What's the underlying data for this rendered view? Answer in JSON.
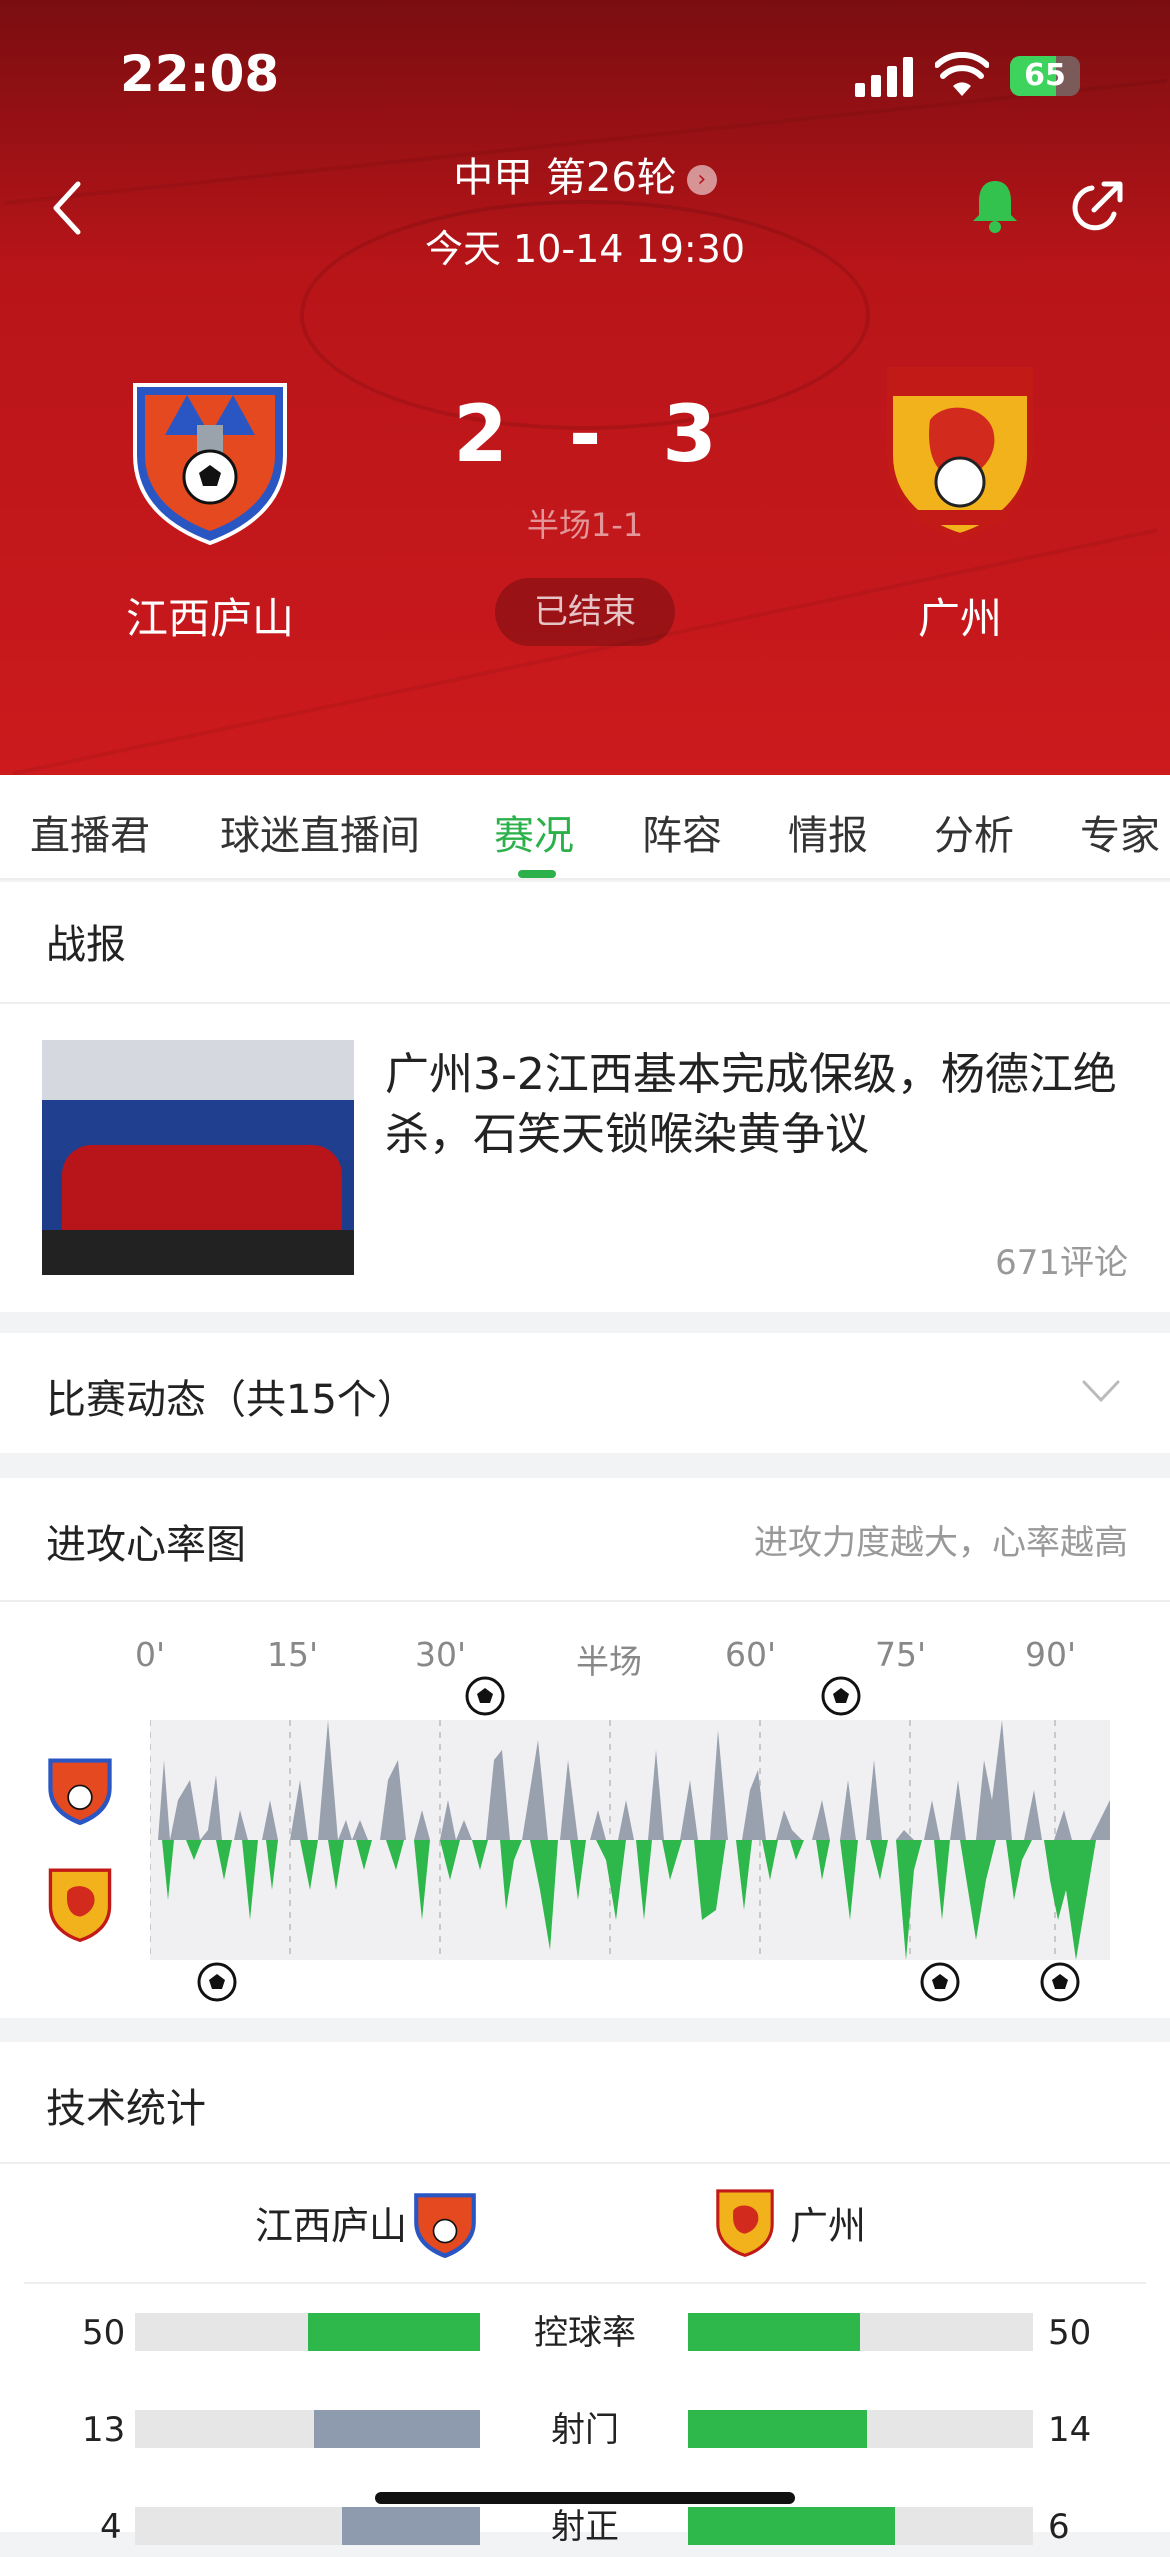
{
  "status_bar": {
    "time": "22:08",
    "battery": "65"
  },
  "match": {
    "league": "中甲 第26轮",
    "datetime": "今天 10-14 19:30",
    "home_team": "江西庐山",
    "away_team": "广州",
    "score_home": "2",
    "score_sep": "-",
    "score_away": "3",
    "half_time": "半场1-1",
    "status": "已结束"
  },
  "tabs": [
    "直播君",
    "球迷直播间",
    "赛况",
    "阵容",
    "情报",
    "分析",
    "专家"
  ],
  "active_tab": "赛况",
  "report": {
    "section_title": "战报",
    "headline": "广州3-2江西基本完成保级，杨德江绝杀，石笑天锁喉染黄争议",
    "comments": "671评论"
  },
  "events": {
    "title": "比赛动态（共15个）"
  },
  "heart_rate": {
    "title": "进攻心率图",
    "hint": "进攻力度越大，心率越高",
    "timeline": [
      "0'",
      "15'",
      "30'",
      "半场",
      "60'",
      "75'",
      "90'"
    ]
  },
  "stats": {
    "title": "技术统计",
    "home_team": "江西庐山",
    "away_team": "广州",
    "rows": [
      {
        "label": "控球率",
        "home": "50",
        "away": "50"
      },
      {
        "label": "射门",
        "home": "13",
        "away": "14"
      },
      {
        "label": "射正",
        "home": "4",
        "away": "6"
      }
    ]
  },
  "colors": {
    "brand_red": "#c8171b",
    "accent_green": "#2cb04a",
    "stat_gray": "#8e9aae"
  }
}
